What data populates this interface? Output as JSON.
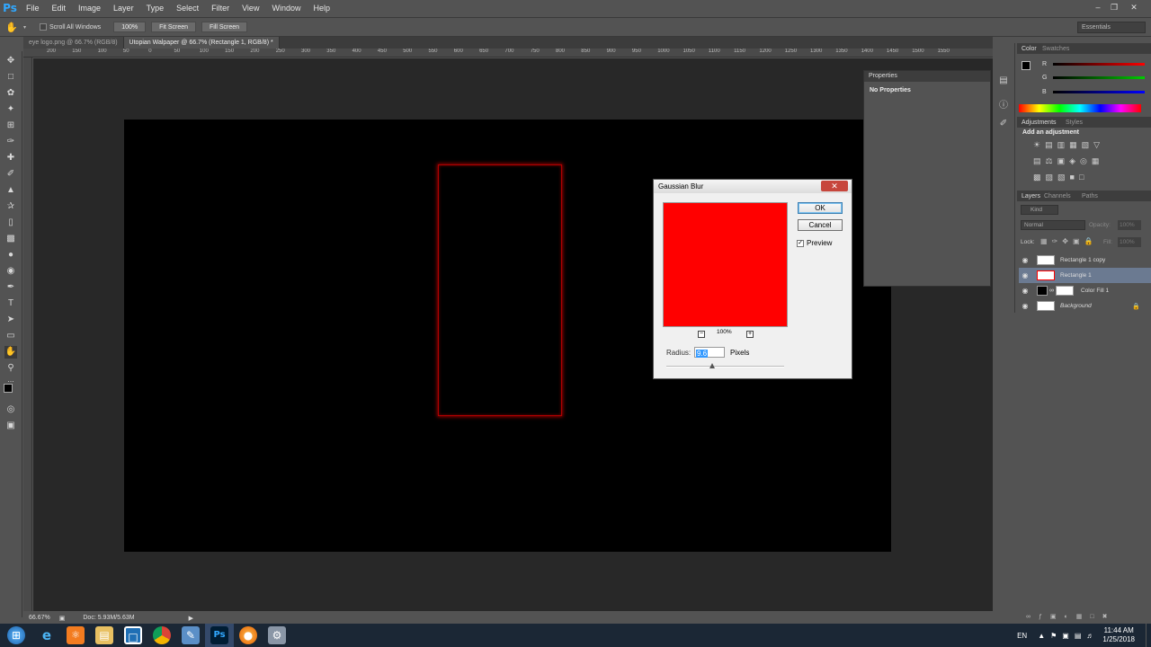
{
  "app": {
    "logo": "Ps"
  },
  "menu": [
    "File",
    "Edit",
    "Image",
    "Layer",
    "Type",
    "Select",
    "Filter",
    "View",
    "Window",
    "Help"
  ],
  "options": {
    "scroll_all": "Scroll All Windows",
    "zoom": "100%",
    "fit": "Fit Screen",
    "fill": "Fill Screen",
    "workspace": "Essentials"
  },
  "tabs": [
    "eye logo.png @ 66.7% (RGB/8)",
    "Utopian Walpaper @ 66.7% (Rectangle 1, RGB/8) *"
  ],
  "ruler_top": [
    "200",
    "150",
    "100",
    "50",
    "0",
    "50",
    "100",
    "150",
    "200",
    "250",
    "300",
    "350",
    "400",
    "450",
    "500",
    "550",
    "600",
    "650",
    "700",
    "750",
    "800",
    "850",
    "900",
    "950",
    "1000",
    "1050",
    "1100",
    "1150",
    "1200",
    "1250",
    "1300",
    "1350",
    "1400",
    "1450",
    "1500",
    "1550"
  ],
  "status": {
    "zoom": "66.67%",
    "doc": "Doc: 5.93M/5.63M"
  },
  "properties": {
    "title": "Properties",
    "empty": "No Properties"
  },
  "dialog": {
    "title": "Gaussian Blur",
    "ok": "OK",
    "cancel": "Cancel",
    "preview_label": "Preview",
    "preview_zoom": "100%",
    "radius_label": "Radius:",
    "radius_value": "9.6",
    "radius_unit": "Pixels",
    "preview_color": "#ff0000"
  },
  "color_panel": {
    "tab_color": "Color",
    "tab_swatches": "Swatches",
    "r": "R",
    "g": "G",
    "b": "B"
  },
  "adjustments": {
    "tab": "Adjustments",
    "tab2": "Styles",
    "heading": "Add an adjustment"
  },
  "layers_panel": {
    "tabs": [
      "Layers",
      "Channels",
      "Paths"
    ],
    "kind": "Kind",
    "blend": "Normal",
    "opacity_label": "Opacity:",
    "opacity": "100%",
    "lock_label": "Lock:",
    "fill_label": "Fill:",
    "fill": "100%",
    "layers": [
      {
        "name": "Rectangle 1 copy",
        "selected": false,
        "italic": false
      },
      {
        "name": "Rectangle 1",
        "selected": true,
        "italic": false
      },
      {
        "name": "Color Fill 1",
        "selected": false,
        "italic": false
      },
      {
        "name": "Background",
        "selected": false,
        "italic": true
      }
    ]
  },
  "taskbar": {
    "lang": "EN",
    "time": "11:44 AM",
    "date": "1/25/2018"
  }
}
